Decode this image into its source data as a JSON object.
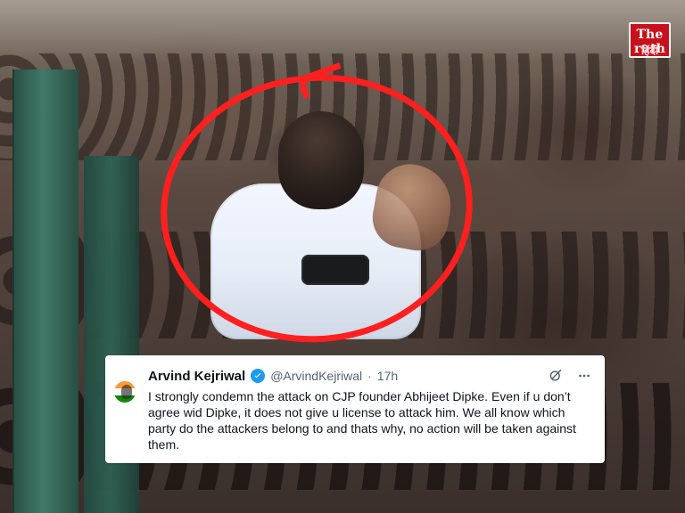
{
  "watermark": {
    "logo_text": "The ruth",
    "sub_text": "हिंदी"
  },
  "tweet": {
    "author_name": "Arvind Kejriwal",
    "handle": "@ArvindKejriwal",
    "dot": "·",
    "time": "17h",
    "text": "I strongly condemn the attack on CJP founder Abhijeet Dipke. Even if u don’t agree wid Dipke, it does not give u license to attack him. We all know which party do the attackers belong to and thats why, no action will be taken against them.",
    "icons": {
      "grok": "grok-icon",
      "more": "more-options-icon",
      "verified": "verified-badge-icon"
    },
    "colors": {
      "verified": "#1d9bf0",
      "text": "#0f1419",
      "muted": "#536471"
    }
  },
  "annotations": {
    "highlight_color": "#ff1f1f"
  }
}
